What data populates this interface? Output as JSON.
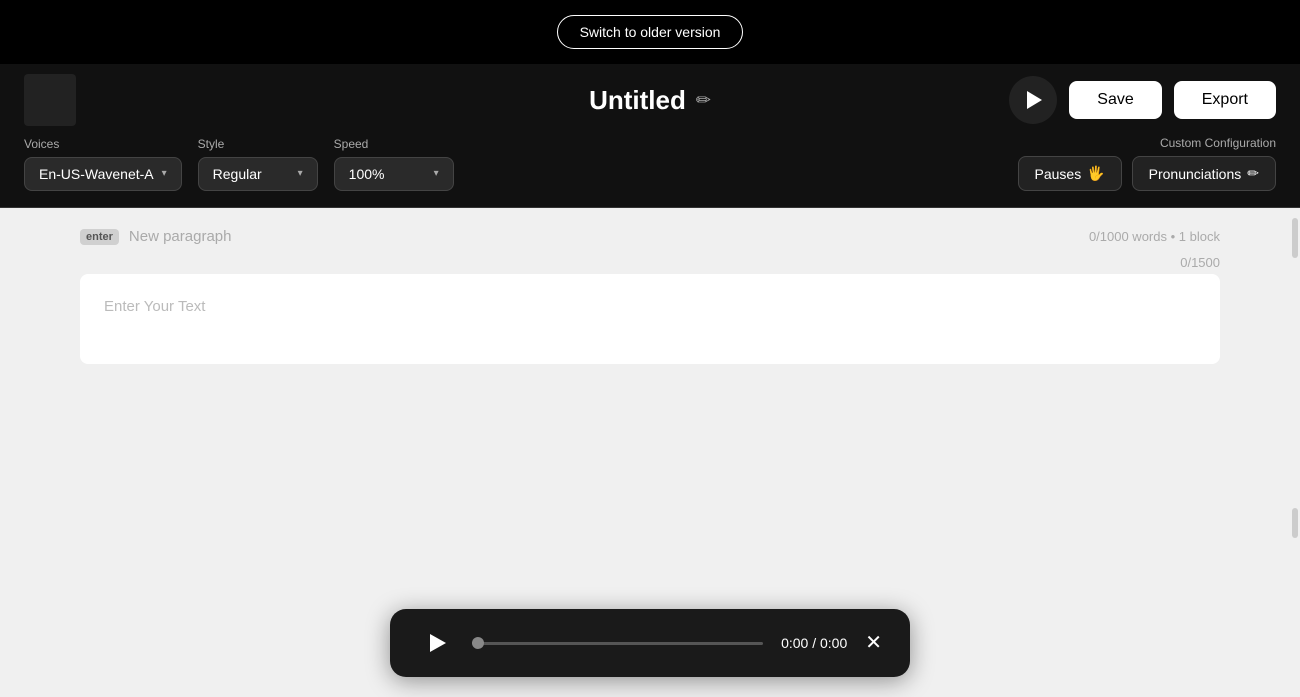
{
  "topBanner": {
    "switchLabel": "Switch to older version"
  },
  "header": {
    "title": "Untitled",
    "editIconLabel": "✏",
    "playLabel": "▶",
    "saveLabel": "Save",
    "exportLabel": "Export"
  },
  "toolbar": {
    "voicesLabel": "Voices",
    "voicesValue": "En-US-Wavenet-A",
    "styleLabel": "Style",
    "styleValue": "Regular",
    "speedLabel": "Speed",
    "speedValue": "100%",
    "customConfigLabel": "Custom Configuration",
    "pausesLabel": "Pauses",
    "pausesIcon": "🖐",
    "pronunciationsLabel": "Pronunciations",
    "pronunciationsIcon": "✏"
  },
  "editor": {
    "enterBadge": "enter",
    "newParagraphPlaceholder": "New paragraph",
    "wordCount": "0/1000 words",
    "blockCount": "1 block",
    "charCount": "0/1500",
    "textPlaceholder": "Enter Your Text"
  },
  "player": {
    "currentTime": "0:00",
    "totalTime": "0:00",
    "separator": "/"
  }
}
